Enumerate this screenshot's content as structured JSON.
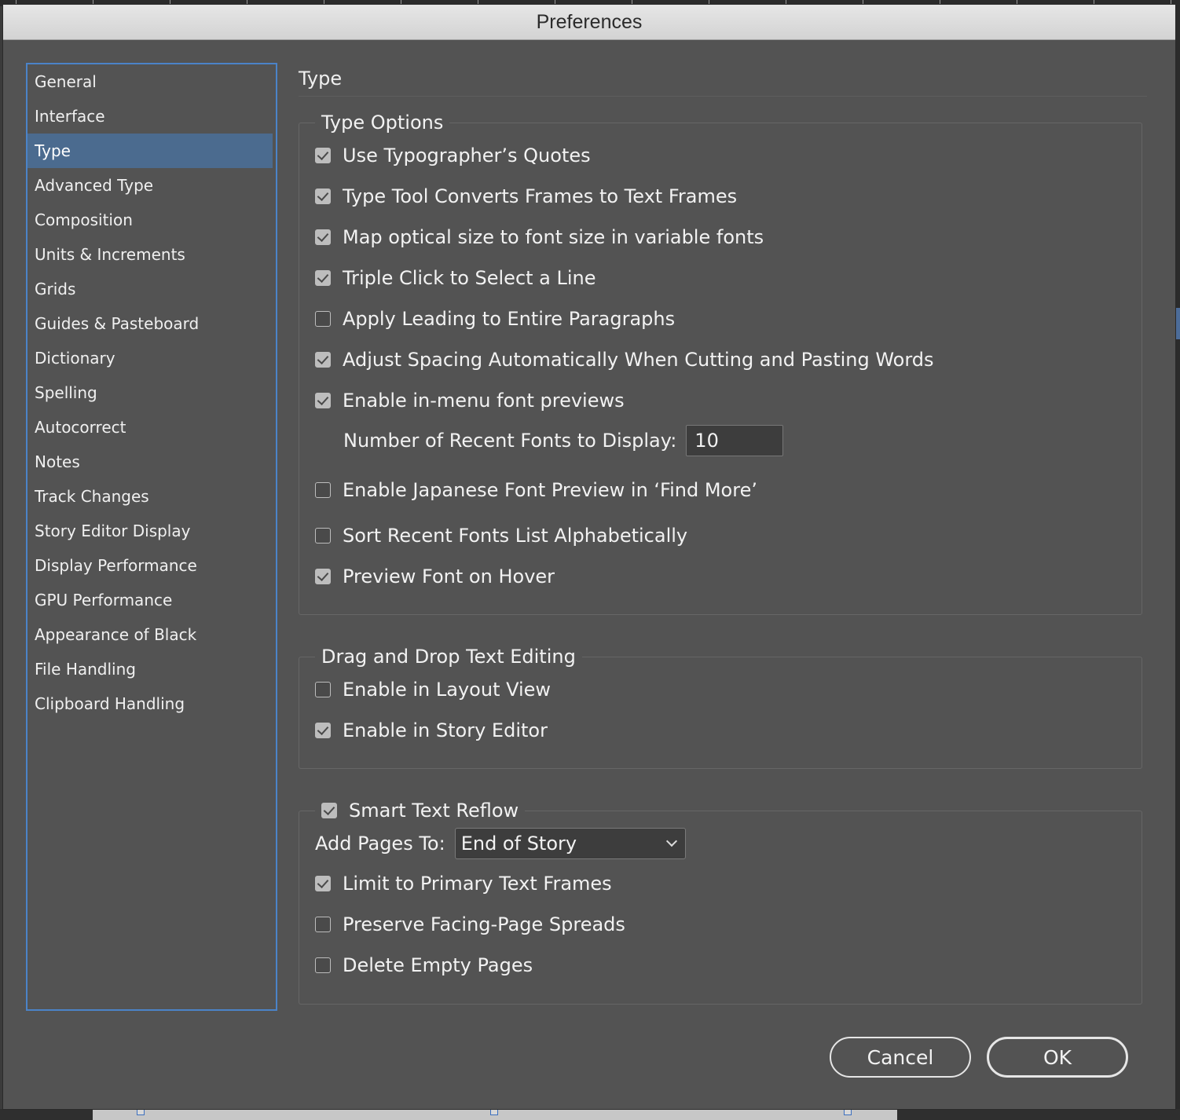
{
  "window": {
    "title": "Preferences"
  },
  "sidebar": {
    "items": [
      {
        "label": "General",
        "selected": false
      },
      {
        "label": "Interface",
        "selected": false
      },
      {
        "label": "Type",
        "selected": true
      },
      {
        "label": "Advanced Type",
        "selected": false
      },
      {
        "label": "Composition",
        "selected": false
      },
      {
        "label": "Units & Increments",
        "selected": false
      },
      {
        "label": "Grids",
        "selected": false
      },
      {
        "label": "Guides & Pasteboard",
        "selected": false
      },
      {
        "label": "Dictionary",
        "selected": false
      },
      {
        "label": "Spelling",
        "selected": false
      },
      {
        "label": "Autocorrect",
        "selected": false
      },
      {
        "label": "Notes",
        "selected": false
      },
      {
        "label": "Track Changes",
        "selected": false
      },
      {
        "label": "Story Editor Display",
        "selected": false
      },
      {
        "label": "Display Performance",
        "selected": false
      },
      {
        "label": "GPU Performance",
        "selected": false
      },
      {
        "label": "Appearance of Black",
        "selected": false
      },
      {
        "label": "File Handling",
        "selected": false
      },
      {
        "label": "Clipboard Handling",
        "selected": false
      }
    ]
  },
  "main": {
    "title": "Type",
    "type_options": {
      "title": "Type Options",
      "options": [
        {
          "label": "Use Typographer’s Quotes",
          "checked": true
        },
        {
          "label": "Type Tool Converts Frames to Text Frames",
          "checked": true
        },
        {
          "label": "Map optical size to font size in variable fonts",
          "checked": true
        },
        {
          "label": "Triple Click to Select a Line",
          "checked": true
        },
        {
          "label": "Apply Leading to Entire Paragraphs",
          "checked": false
        },
        {
          "label": "Adjust Spacing Automatically When Cutting and Pasting Words",
          "checked": true
        },
        {
          "label": "Enable in-menu font previews",
          "checked": true
        }
      ],
      "recent_fonts": {
        "label": "Number of Recent Fonts to Display:",
        "value": "10"
      },
      "options_after": [
        {
          "label": "Enable Japanese Font Preview in ‘Find More’",
          "checked": false
        },
        {
          "label": "Sort Recent Fonts List Alphabetically",
          "checked": false
        },
        {
          "label": "Preview Font on Hover",
          "checked": true
        }
      ]
    },
    "drag_drop": {
      "title": "Drag and Drop Text Editing",
      "options": [
        {
          "label": "Enable in Layout View",
          "checked": false
        },
        {
          "label": "Enable in Story Editor",
          "checked": true
        }
      ]
    },
    "smart_reflow": {
      "title": "Smart Text Reflow",
      "checked": true,
      "add_pages": {
        "label": "Add Pages To:",
        "value": "End of Story"
      },
      "options": [
        {
          "label": "Limit to Primary Text Frames",
          "checked": true
        },
        {
          "label": "Preserve Facing-Page Spreads",
          "checked": false
        },
        {
          "label": "Delete Empty Pages",
          "checked": false
        }
      ]
    }
  },
  "buttons": {
    "cancel": "Cancel",
    "ok": "OK"
  }
}
